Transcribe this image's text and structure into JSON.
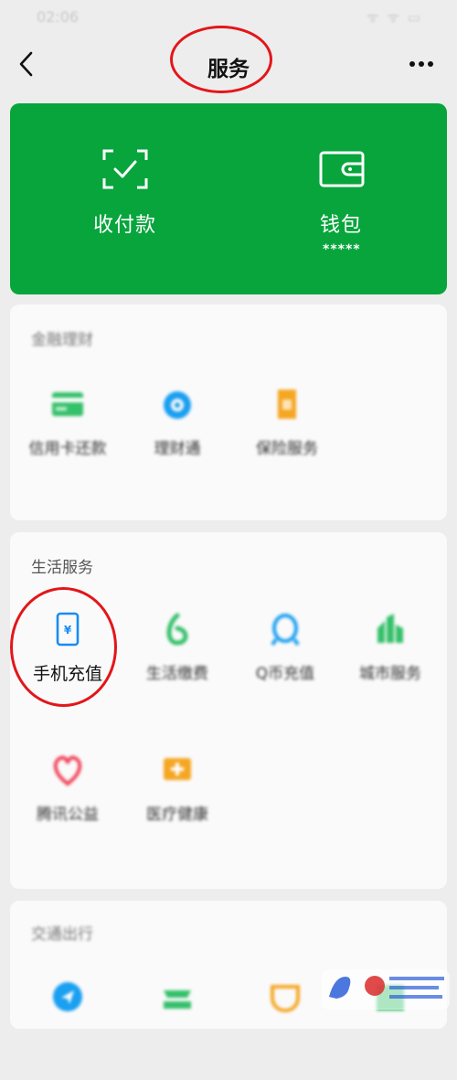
{
  "status_bar": {
    "time": "02:06",
    "icons": "ᯤ ᯤ ▭"
  },
  "header": {
    "title": "服务",
    "back_icon": "chevron-left-icon",
    "more_icon": "more-icon"
  },
  "wallet_card": {
    "background": "#07a53c",
    "pay": {
      "label": "收付款",
      "icon": "scan-icon"
    },
    "wallet": {
      "label": "钱包",
      "balance_mask": "*****",
      "icon": "wallet-icon"
    }
  },
  "finance": {
    "title": "金融理财",
    "items": [
      {
        "label": "信用卡还款",
        "icon": "credit-card-icon",
        "color": "#35c06a"
      },
      {
        "label": "理财通",
        "icon": "wealth-icon",
        "color": "#1a9ff1"
      },
      {
        "label": "保险服务",
        "icon": "insurance-icon",
        "color": "#f5a623"
      }
    ]
  },
  "life": {
    "title": "生活服务",
    "items": [
      {
        "label": "手机充值",
        "icon": "phone-topup-icon",
        "color": "#1a8cf0"
      },
      {
        "label": "生活缴费",
        "icon": "utility-icon",
        "color": "#35c06a"
      },
      {
        "label": "Q币充值",
        "icon": "qq-coin-icon",
        "color": "#1a9ff1"
      },
      {
        "label": "城市服务",
        "icon": "city-service-icon",
        "color": "#35c06a"
      },
      {
        "label": "腾讯公益",
        "icon": "charity-icon",
        "color": "#f0445a"
      },
      {
        "label": "医疗健康",
        "icon": "health-icon",
        "color": "#f5a623"
      }
    ]
  },
  "transport": {
    "title": "交通出行",
    "items": [
      {
        "icon": "navigation-icon",
        "color": "#1a9ff1"
      },
      {
        "icon": "train-icon",
        "color": "#35c06a"
      },
      {
        "icon": "didi-icon",
        "color": "#f5a623"
      },
      {
        "icon": "hotel-icon",
        "color": "#35c06a"
      }
    ]
  },
  "annotation_color": "#e3161a"
}
